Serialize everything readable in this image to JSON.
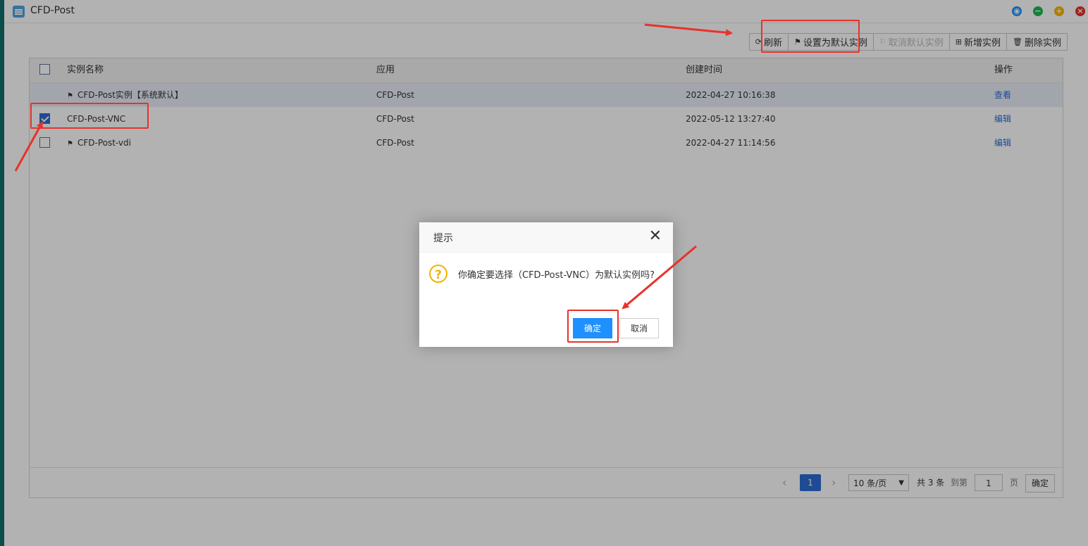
{
  "window": {
    "title": "CFD-Post"
  },
  "toolbar": {
    "refresh": "刷新",
    "set_default": "设置为默认实例",
    "cancel_default": "取消默认实例",
    "add": "新增实例",
    "delete": "删除实例"
  },
  "table": {
    "headers": [
      "实例名称",
      "应用",
      "创建时间",
      "操作"
    ],
    "rows": [
      {
        "name": "CFD-Post实例【系统默认】",
        "app": "CFD-Post",
        "created": "2022-04-27 10:16:38",
        "action": "查看"
      },
      {
        "name": "CFD-Post-VNC",
        "app": "CFD-Post",
        "created": "2022-05-12 13:27:40",
        "action": "编辑"
      },
      {
        "name": "CFD-Post-vdi",
        "app": "CFD-Post",
        "created": "2022-04-27 11:14:56",
        "action": "编辑"
      }
    ]
  },
  "pager": {
    "current": "1",
    "page_size": "10 条/页",
    "total": "共 3 条",
    "goto_label": "到第",
    "goto_value": "1",
    "page_unit": "页",
    "confirm": "确定"
  },
  "dialog": {
    "title": "提示",
    "message": "你确定要选择（CFD-Post-VNC）为默认实例吗?",
    "ok": "确定",
    "cancel": "取消"
  },
  "colors": {
    "accent": "#2d6cd4",
    "ok_button": "#1e90ff",
    "annotation": "#e8322a",
    "warning": "#f0b400"
  }
}
